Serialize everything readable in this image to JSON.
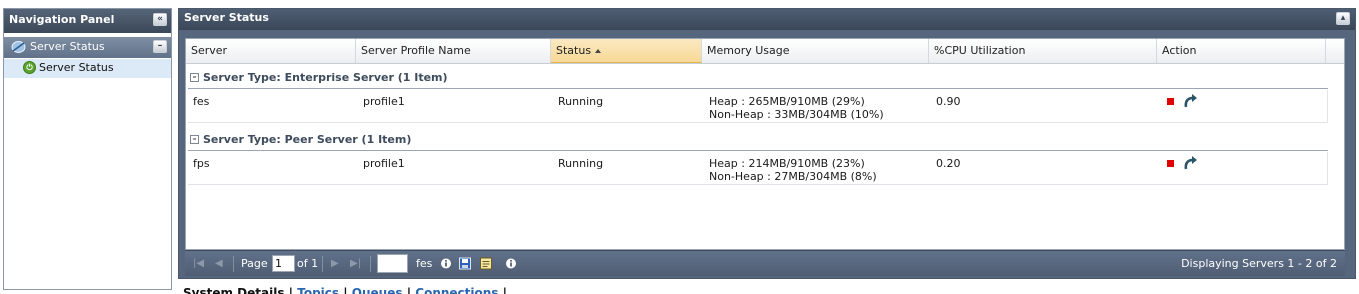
{
  "nav": {
    "title": "Navigation Panel",
    "group_label": "Server Status",
    "item_label": "Server Status"
  },
  "main": {
    "title": "Server Status"
  },
  "grid": {
    "columns": [
      "Server",
      "Server Profile Name",
      "Status",
      "Memory Usage",
      "%CPU Utilization",
      "Action"
    ],
    "sorted_column": "Status",
    "sort_direction": "ascending",
    "groups": [
      {
        "label": "Server Type: Enterprise Server (1 Item)",
        "rows": [
          {
            "server": "fes",
            "profile": "profile1",
            "status": "Running",
            "heap": "Heap : 265MB/910MB (29%)",
            "nonheap": "Non-Heap : 33MB/304MB (10%)",
            "cpu": "0.90"
          }
        ]
      },
      {
        "label": "Server Type: Peer Server (1 Item)",
        "rows": [
          {
            "server": "fps",
            "profile": "profile1",
            "status": "Running",
            "heap": "Heap : 214MB/910MB (23%)",
            "nonheap": "Non-Heap : 27MB/304MB (8%)",
            "cpu": "0.20"
          }
        ]
      }
    ]
  },
  "pager": {
    "page_label": "Page",
    "page_value": "1",
    "of_label": "of 1",
    "server_label": "fes",
    "display_text": "Displaying Servers 1 - 2 of 2"
  },
  "bottom_links": {
    "system_details": "System Details",
    "topics": "Topics",
    "queues": "Queues",
    "connections": "Connections",
    "separator": "|"
  },
  "colors": {
    "header_dark": "#3b4859",
    "sorted_header": "#f7d996",
    "stop_action": "#e00000",
    "link": "#2a66b0"
  }
}
